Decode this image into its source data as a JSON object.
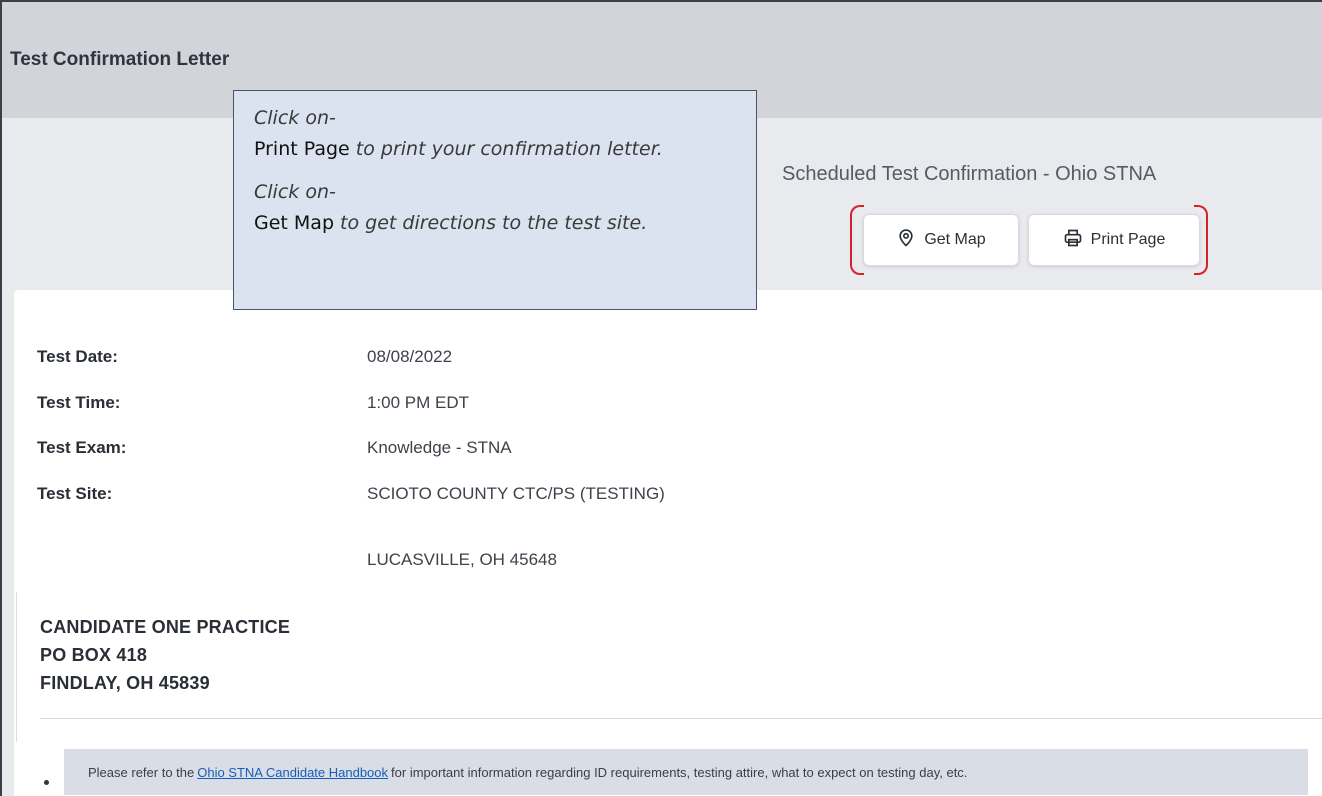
{
  "header": {
    "title": "Test Confirmation Letter"
  },
  "callout": {
    "line1_prefix": "Click on-",
    "line1_action": "Print Page",
    "line1_suffix": " to print your confirmation letter.",
    "line2_prefix": "Click on-",
    "line2_action": "Get Map",
    "line2_suffix": " to get directions to the test site."
  },
  "scheduled": {
    "title": "Scheduled Test Confirmation - Ohio STNA",
    "get_map_label": "Get Map",
    "print_page_label": "Print Page"
  },
  "details": [
    {
      "label": "Test Date:",
      "value": "08/08/2022"
    },
    {
      "label": "Test Time:",
      "value": "1:00 PM EDT"
    },
    {
      "label": "Test Exam:",
      "value": "Knowledge - STNA"
    },
    {
      "label": "Test Site:",
      "value": "SCIOTO COUNTY CTC/PS (TESTING)"
    }
  ],
  "site_city": "LUCASVILLE, OH 45648",
  "candidate": {
    "name": "CANDIDATE ONE PRACTICE",
    "line1": "PO BOX 418",
    "line2": "FINDLAY, OH 45839"
  },
  "notice": {
    "prefix": "Please refer to the",
    "link_text": "Ohio STNA Candidate Handbook",
    "suffix": "for important information regarding ID requirements, testing attire, what to expect on testing day, etc."
  },
  "colors": {
    "accent_red": "#d6202a",
    "callout_bg": "#dae3ef",
    "header_bg": "#d2d4d9"
  },
  "icons": {
    "map": "map-pin-icon",
    "print": "printer-icon"
  }
}
